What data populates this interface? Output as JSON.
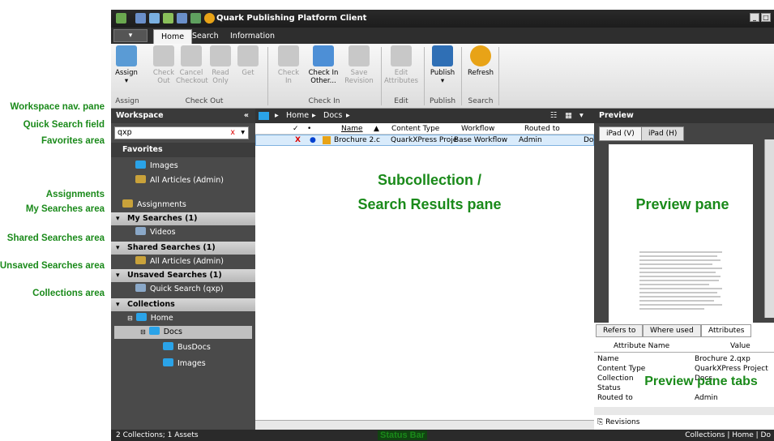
{
  "annotations": {
    "workspace_nav": "Workspace nav. pane",
    "quick_search": "Quick Search field",
    "favorites": "Favorites area",
    "assignments": "Assignments",
    "my_searches": "My Searches area",
    "shared_searches": "Shared Searches area",
    "unsaved_searches": "Unsaved Searches area",
    "collections": "Collections area",
    "subcollection_line1": "Subcollection /",
    "subcollection_line2": "Search Results pane",
    "preview_pane": "Preview pane",
    "preview_tabs": "Preview pane tabs",
    "status_bar": "Status Bar"
  },
  "window": {
    "title": "Quark Publishing Platform Client",
    "min": "_",
    "max": "□"
  },
  "tabs": [
    "Home",
    "Search",
    "Information"
  ],
  "ribbon": {
    "buttons": [
      {
        "label": "Assign",
        "sub": "▾",
        "disabled": false,
        "color": "#5a9bd5"
      },
      {
        "label": "Check",
        "sub": "Out",
        "disabled": true,
        "color": "#c8c8c8"
      },
      {
        "label": "Cancel",
        "sub": "Checkout",
        "disabled": true,
        "color": "#c8c8c8"
      },
      {
        "label": "Read",
        "sub": "Only",
        "disabled": true,
        "color": "#c8c8c8"
      },
      {
        "label": "Get",
        "sub": "",
        "disabled": true,
        "color": "#c8c8c8"
      },
      {
        "label": "Check",
        "sub": "In",
        "disabled": true,
        "color": "#c8c8c8"
      },
      {
        "label": "Check In",
        "sub": "Other...",
        "disabled": false,
        "color": "#4d8fd6"
      },
      {
        "label": "Save",
        "sub": "Revision",
        "disabled": true,
        "color": "#c8c8c8"
      },
      {
        "label": "Edit",
        "sub": "Attributes",
        "disabled": true,
        "color": "#c8c8c8"
      },
      {
        "label": "Publish",
        "sub": "▾",
        "disabled": false,
        "color": "#2f6fb5"
      },
      {
        "label": "Refresh",
        "sub": "",
        "disabled": false,
        "color": "#e8a317"
      }
    ],
    "groups": [
      "Assign",
      "Check Out",
      "Check In",
      "Edit",
      "Publish",
      "Search"
    ]
  },
  "workspace": {
    "title": "Workspace",
    "collapse": "«",
    "search_value": "qxp",
    "search_clear": "x",
    "search_arrow": "▾",
    "favorites_label": "Favorites",
    "favorites": [
      "Images",
      "All Articles (Admin)"
    ],
    "assignments": "Assignments",
    "my_searches": "My Searches (1)",
    "my_searches_items": [
      "Videos"
    ],
    "shared_searches": "Shared Searches (1)",
    "shared_items": [
      "All Articles (Admin)"
    ],
    "unsaved_searches": "Unsaved Searches (1)",
    "unsaved_items": [
      "Quick Search (qxp)"
    ],
    "collections": "Collections",
    "tree": [
      "Home",
      "Docs",
      "BusDocs",
      "Images"
    ]
  },
  "results": {
    "breadcrumb": [
      "Home",
      "Docs"
    ],
    "sep": "▸",
    "columns": [
      "Name",
      "Content Type",
      "Workflow",
      "Routed to"
    ],
    "row": {
      "mark": "X",
      "dot": "●",
      "name": "Brochure 2.c",
      "type": "QuarkXPress Proje",
      "workflow": "Base Workflow",
      "routed": "Admin",
      "extra": "Do"
    }
  },
  "preview": {
    "title": "Preview",
    "device_tabs": [
      "iPad (V)",
      "iPad (H)"
    ],
    "lower_tabs": [
      "Refers to",
      "Where used",
      "Attributes"
    ],
    "attr_headers": [
      "Attribute Name",
      "Value"
    ],
    "attrs": [
      {
        "name": "Name",
        "value": "Brochure 2.qxp"
      },
      {
        "name": "Content Type",
        "value": "QuarkXPress Project"
      },
      {
        "name": "Collection",
        "value": "Docs"
      },
      {
        "name": "Status",
        "value": ""
      },
      {
        "name": "Routed to",
        "value": "Admin"
      }
    ],
    "revisions": "Revisions"
  },
  "status": {
    "left": "2 Collections; 1 Assets",
    "right": "Collections | Home | Do"
  }
}
